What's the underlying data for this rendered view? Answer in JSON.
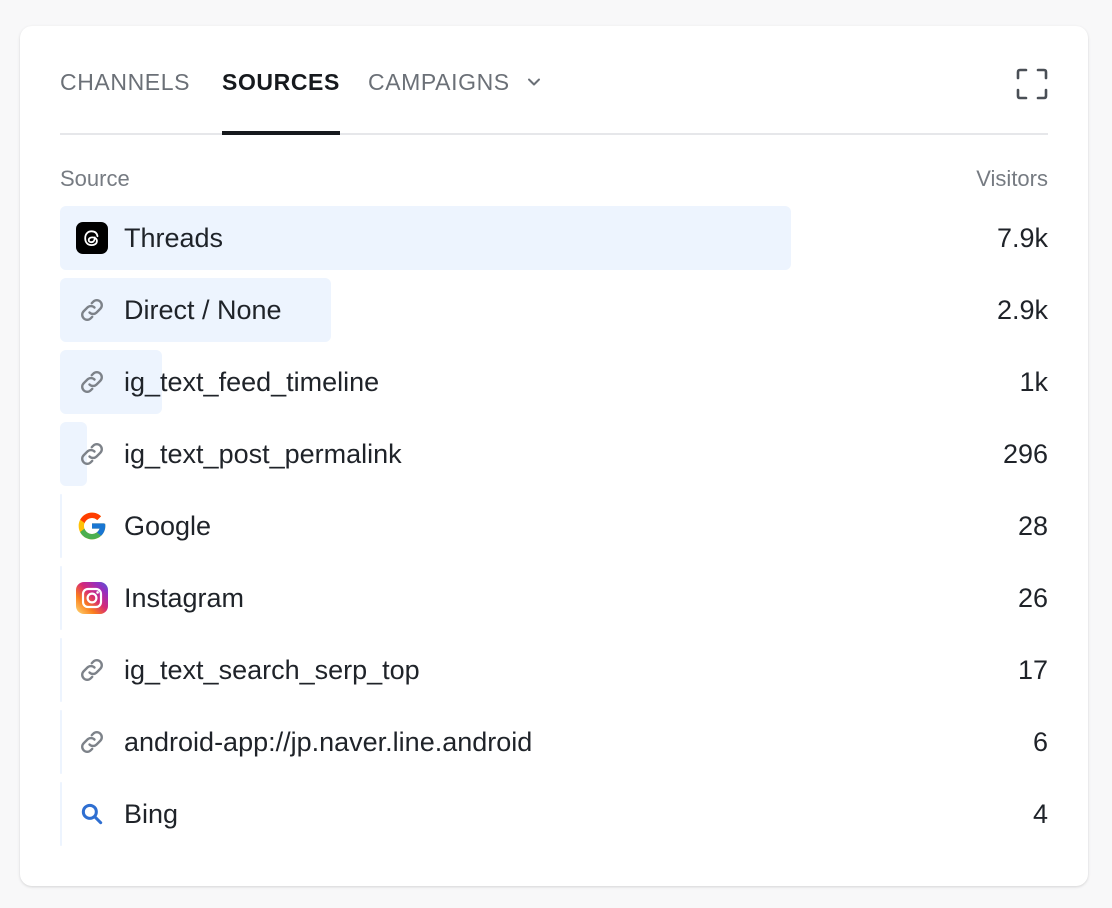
{
  "tabs": [
    {
      "label": "CHANNELS",
      "active": false
    },
    {
      "label": "SOURCES",
      "active": true
    },
    {
      "label": "CAMPAIGNS",
      "active": false
    }
  ],
  "columns": {
    "source": "Source",
    "visitors": "Visitors"
  },
  "colors": {
    "bar": "#edf4fe",
    "active_tab": "#16191d",
    "inactive_tab": "#6b7077"
  },
  "rows": [
    {
      "label": "Threads",
      "value": "7.9k",
      "icon": "threads-icon",
      "share": 0.74
    },
    {
      "label": "Direct / None",
      "value": "2.9k",
      "icon": "link-icon",
      "share": 0.274
    },
    {
      "label": "ig_text_feed_timeline",
      "value": "1k",
      "icon": "link-icon",
      "share": 0.103
    },
    {
      "label": "ig_text_post_permalink",
      "value": "296",
      "icon": "link-icon",
      "share": 0.027
    },
    {
      "label": "Google",
      "value": "28",
      "icon": "google-icon",
      "share": 0.002
    },
    {
      "label": "Instagram",
      "value": "26",
      "icon": "instagram-icon",
      "share": 0.002
    },
    {
      "label": "ig_text_search_serp_top",
      "value": "17",
      "icon": "link-icon",
      "share": 0.0015
    },
    {
      "label": "android-app://jp.naver.line.android",
      "value": "6",
      "icon": "link-icon",
      "share": 0.001
    },
    {
      "label": "Bing",
      "value": "4",
      "icon": "search-icon",
      "share": 0.0
    }
  ]
}
